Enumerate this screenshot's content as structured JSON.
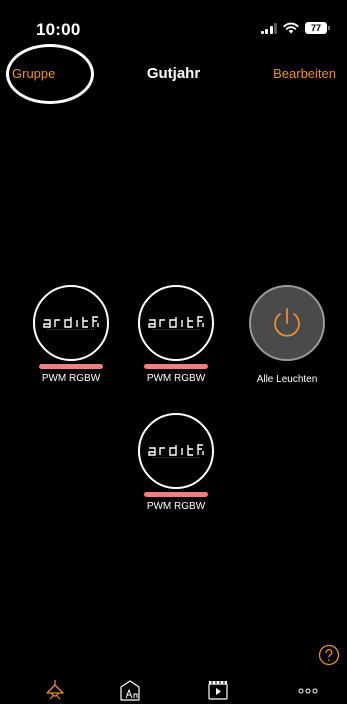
{
  "status_bar": {
    "time": "10:00",
    "battery": "77"
  },
  "nav": {
    "left_label": "Gruppe",
    "title": "Gutjahr",
    "right_label": "Bearbeiten"
  },
  "colors": {
    "accent": "#e8902f",
    "indicator_bar": "#f08080",
    "background": "#000000"
  },
  "devices": [
    {
      "label": "PWM RGBW",
      "logo": "ardifi",
      "indicator_color": "#f08080"
    },
    {
      "label": "PWM RGBW",
      "logo": "ardifi",
      "indicator_color": "#f08080"
    },
    {
      "label": "PWM RGBW",
      "logo": "ardifi",
      "indicator_color": "#f08080"
    }
  ],
  "all_lights": {
    "label": "Alle Leuchten",
    "icon": "power-icon"
  },
  "tabs": [
    {
      "name": "lights-tab",
      "icon": "lamp-icon",
      "active": true
    },
    {
      "name": "rooms-tab",
      "icon": "room-icon",
      "active": false
    },
    {
      "name": "scenes-tab",
      "icon": "clapperboard-icon",
      "active": false
    },
    {
      "name": "more-tab",
      "icon": "more-icon",
      "active": false
    }
  ],
  "help": {
    "icon": "help-icon"
  }
}
